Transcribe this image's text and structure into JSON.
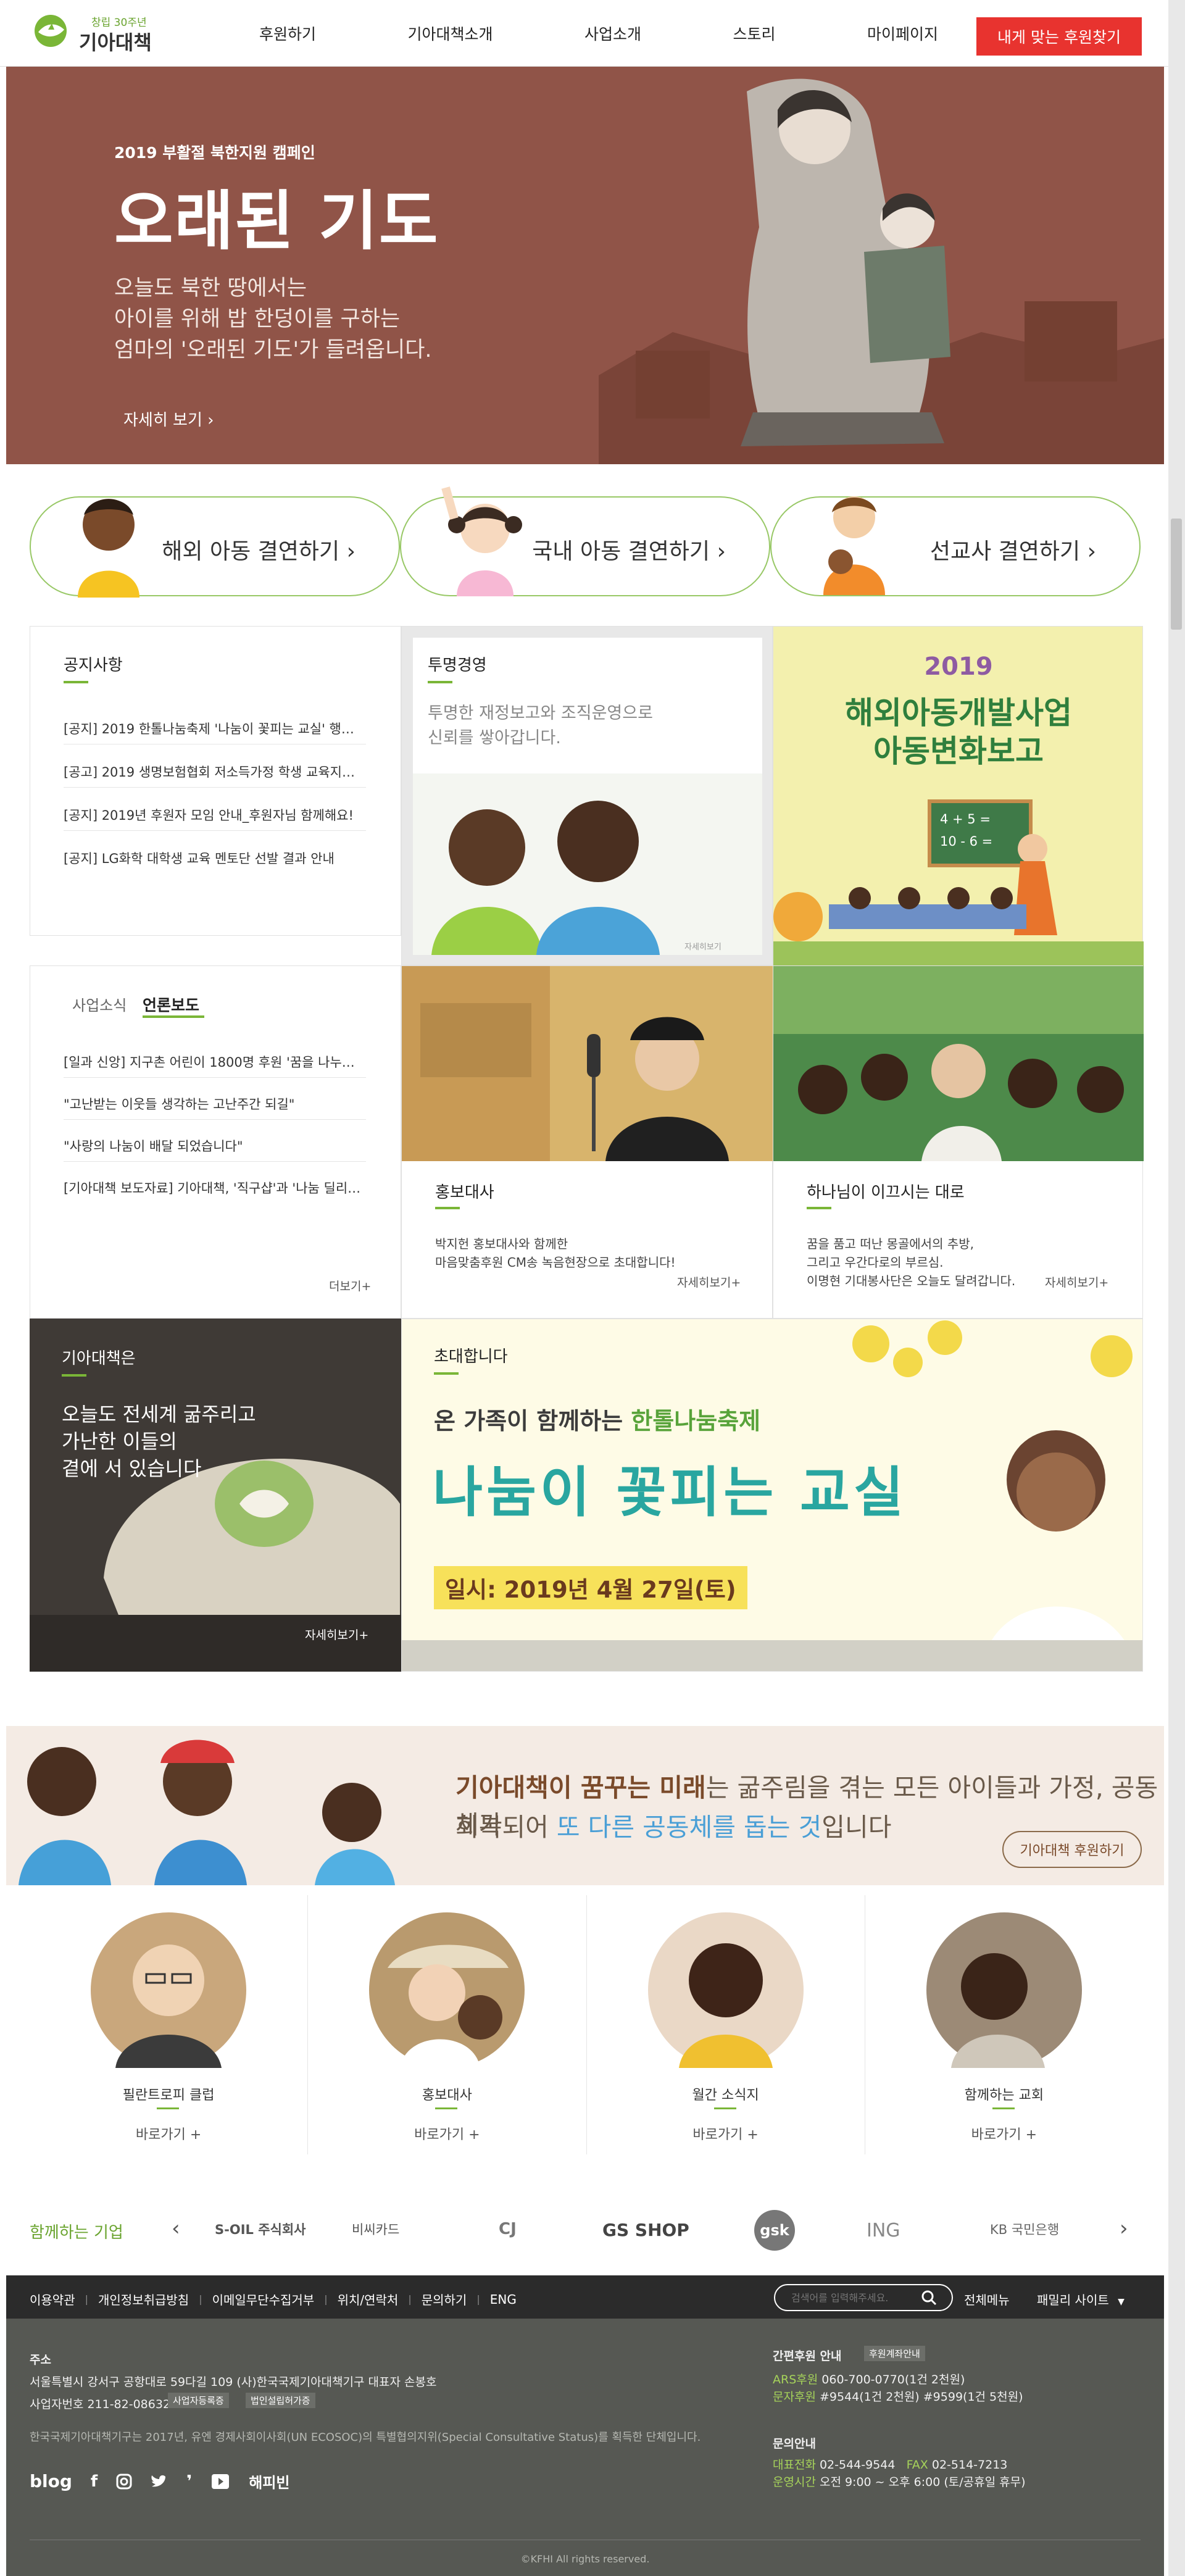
{
  "header": {
    "logo_small": "창립 30주년",
    "logo_big": "기아대책",
    "nav": [
      "후원하기",
      "기아대책소개",
      "사업소개",
      "스토리",
      "마이페이지"
    ],
    "cta": "내게 맞는 후원찾기"
  },
  "hero": {
    "campaign": "2019 부활절 북한지원 캠페인",
    "title": "오래된 기도",
    "lines": [
      "오늘도 북한 땅에서는",
      "아이를 위해 밥 한덩이를 구하는",
      "엄마의 '오래된 기도'가 들려옵니다."
    ],
    "more": "자세히 보기"
  },
  "pills": [
    "해외 아동 결연하기",
    "국내 아동 결연하기",
    "선교사 결연하기"
  ],
  "notice": {
    "title": "공지사항",
    "items": [
      "[공지] 2019 한톨나눔축제 '나눔이 꽃피는 교실' 행사 신...",
      "[공고] 2019 생명보험협회 저소득가정 학생 교육지원사...",
      "[공지] 2019년 후원자 모임 안내_후원자님 함께해요!",
      "[공지] LG화학 대학생 교육 멘토단 선발 결과 안내"
    ]
  },
  "transparency": {
    "title": "투명경영",
    "desc": [
      "투명한 재정보고와 조직운영으로",
      "신뢰를 쌓아갑니다."
    ],
    "caption": "자세히보기"
  },
  "report": {
    "year": "2019",
    "line1": "해외아동개발사업",
    "line2": "아동변화보고",
    "board": [
      "4 + 5 =",
      "10 - 6 ="
    ]
  },
  "press": {
    "tabs": [
      "사업소식",
      "언론보도"
    ],
    "items": [
      "[일과 신앙] 지구촌 어린이 1800명 후원 '꿈을 나누는 기...",
      "\"고난받는 이웃들 생각하는 고난주간 되길\"",
      "\"사랑의 나눔이 배달 되었습니다\"",
      "[기아대책 보도자료] 기아대책, '직구샵'과 '나눔 딜리버..."
    ],
    "more": "더보기+"
  },
  "ambassador": {
    "title": "홍보대사",
    "desc": [
      "박지헌 홍보대사와 함께한",
      "마음맞춤후원 CM송 녹음현장으로 초대합니다!"
    ],
    "more": "자세히보기+"
  },
  "led": {
    "title": "하나님이 이끄시는 대로",
    "desc": [
      "꿈을 품고 떠난 몽골에서의 추방,",
      "그리고 우간다로의 부르심.",
      "이명현 기대봉사단은 오늘도 달려갑니다."
    ],
    "more": "자세히보기+"
  },
  "about": {
    "title": "기아대책은",
    "desc": [
      "오늘도 전세계 굶주리고",
      "가난한 이들의",
      "곁에 서 있습니다"
    ],
    "more": "자세히보기+"
  },
  "invite": {
    "label": "초대합니다",
    "sub1": "온 가족이 함께하는 ",
    "sub2": "한톨나눔축제",
    "title": "나눔이 꽃피는 교실",
    "date": "일시: 2019년 4월 27일(토)"
  },
  "cta_band": {
    "l1a": "기아대책이 꿈꾸는 미래",
    "l1b": "는 굶주림을 겪는 모든 아이들과 가정, 공동체가",
    "l2a": "회복되어 ",
    "l2b": "또 다른 공동체를 돕는 것",
    "l2c": "입니다",
    "button": "기아대책 후원하기"
  },
  "circles": [
    {
      "name": "필란트로피 클럽",
      "link": "바로가기 +"
    },
    {
      "name": "홍보대사",
      "link": "바로가기 +"
    },
    {
      "name": "월간 소식지",
      "link": "바로가기 +"
    },
    {
      "name": "함께하는 교회",
      "link": "바로가기 +"
    }
  ],
  "partners": {
    "title": "함께하는 기업",
    "logos": [
      "S-OIL 주식회사",
      "비씨카드",
      "CJ",
      "GS SHOP",
      "gsk",
      "ING",
      "KB 국민은행"
    ]
  },
  "footer": {
    "links": [
      "이용약관",
      "개인정보취급방침",
      "이메일무단수집거부",
      "위치/연락처",
      "문의하기",
      "ENG"
    ],
    "search_placeholder": "검색어를 입력해주세요.",
    "all_menu": "전체메뉴",
    "family": "패밀리 사이트",
    "addr_title": "주소",
    "addr": "서울특별시 강서구 공항대로 59다길 109 (사)한국국제기아대책기구 대표자 손봉호",
    "bizno": "사업자번호 211-82-08632",
    "badge1": "사업자등록증",
    "badge2": "법인설립허가증",
    "notice": "한국국제기아대책기구는 2017년, 유엔 경제사회이사회(UN ECOSOC)의 특별협의지위(Special Consultative Status)를 획득한 단체입니다.",
    "social_text": "해피빈",
    "donate_title": "간편후원 안내",
    "donate_badge": "후원계좌안내",
    "ars_label": "ARS후원",
    "ars": "060-700-0770(1건 2천원)",
    "sms_label": "문자후원",
    "sms": "#9544(1건 2천원) #9599(1건 5천원)",
    "contact_title": "문의안내",
    "tel_label": "대표전화",
    "tel": "02-544-9544",
    "fax_label": "FAX",
    "fax": "02-514-7213",
    "hours_label": "운영시간",
    "hours": "오전 9:00 ~ 오후 6:00 (토/공휴일 휴무)",
    "copyright": "©KFHI All rights reserved."
  },
  "colors": {
    "accent": "#7ab637",
    "hero_bg": "#905448",
    "cta_red": "#e8332f",
    "footer_bg": "#565853"
  }
}
